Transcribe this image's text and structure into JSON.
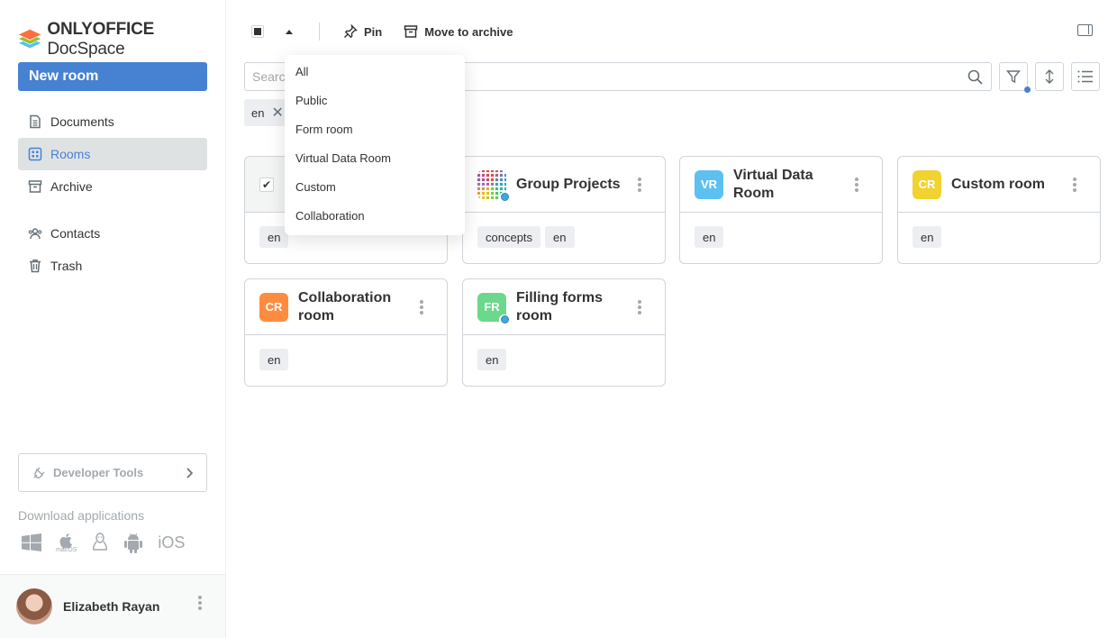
{
  "brand": {
    "name_bold": "ONLYOFFICE",
    "name_rest": " DocSpace"
  },
  "sidebar": {
    "new_room_label": "New room",
    "items": [
      {
        "label": "Documents",
        "icon": "document-icon"
      },
      {
        "label": "Rooms",
        "icon": "rooms-icon",
        "active": true
      },
      {
        "label": "Archive",
        "icon": "archive-icon"
      },
      {
        "label": "Contacts",
        "icon": "contacts-icon"
      },
      {
        "label": "Trash",
        "icon": "trash-icon"
      }
    ],
    "developer_tools_label": "Developer Tools",
    "download_label": "Download applications",
    "apps": {
      "mac_sub": "macOS",
      "ios": "iOS"
    }
  },
  "profile": {
    "name": "Elizabeth Rayan"
  },
  "toolbar": {
    "pin_label": "Pin",
    "archive_label": "Move to archive"
  },
  "search": {
    "placeholder": "Search"
  },
  "filter_chip": {
    "label": "en"
  },
  "dropdown": {
    "options": [
      "All",
      "Public",
      "Form room",
      "Virtual Data Room",
      "Custom",
      "Collaboration"
    ]
  },
  "rooms": [
    {
      "title": "",
      "selected": true,
      "tags": [
        "en"
      ]
    },
    {
      "title": "Group Projects",
      "logo": "qr",
      "public": true,
      "tags": [
        "concepts",
        "en"
      ]
    },
    {
      "title": "Virtual Data Room",
      "initials": "VR",
      "color": "#5ec0f0",
      "tags": [
        "en"
      ]
    },
    {
      "title": "Custom room",
      "initials": "CR",
      "color": "#f2d230",
      "tags": [
        "en"
      ]
    },
    {
      "title": "Collaboration room",
      "initials": "CR",
      "color": "#ff8b3e",
      "tags": [
        "en"
      ]
    },
    {
      "title": "Filling forms room",
      "initials": "FR",
      "color": "#6bd88b",
      "public": true,
      "tags": [
        "en"
      ]
    }
  ],
  "colors": {
    "accent": "#4781d1",
    "border": "#d0d5da",
    "muted": "#a3a9ae"
  }
}
